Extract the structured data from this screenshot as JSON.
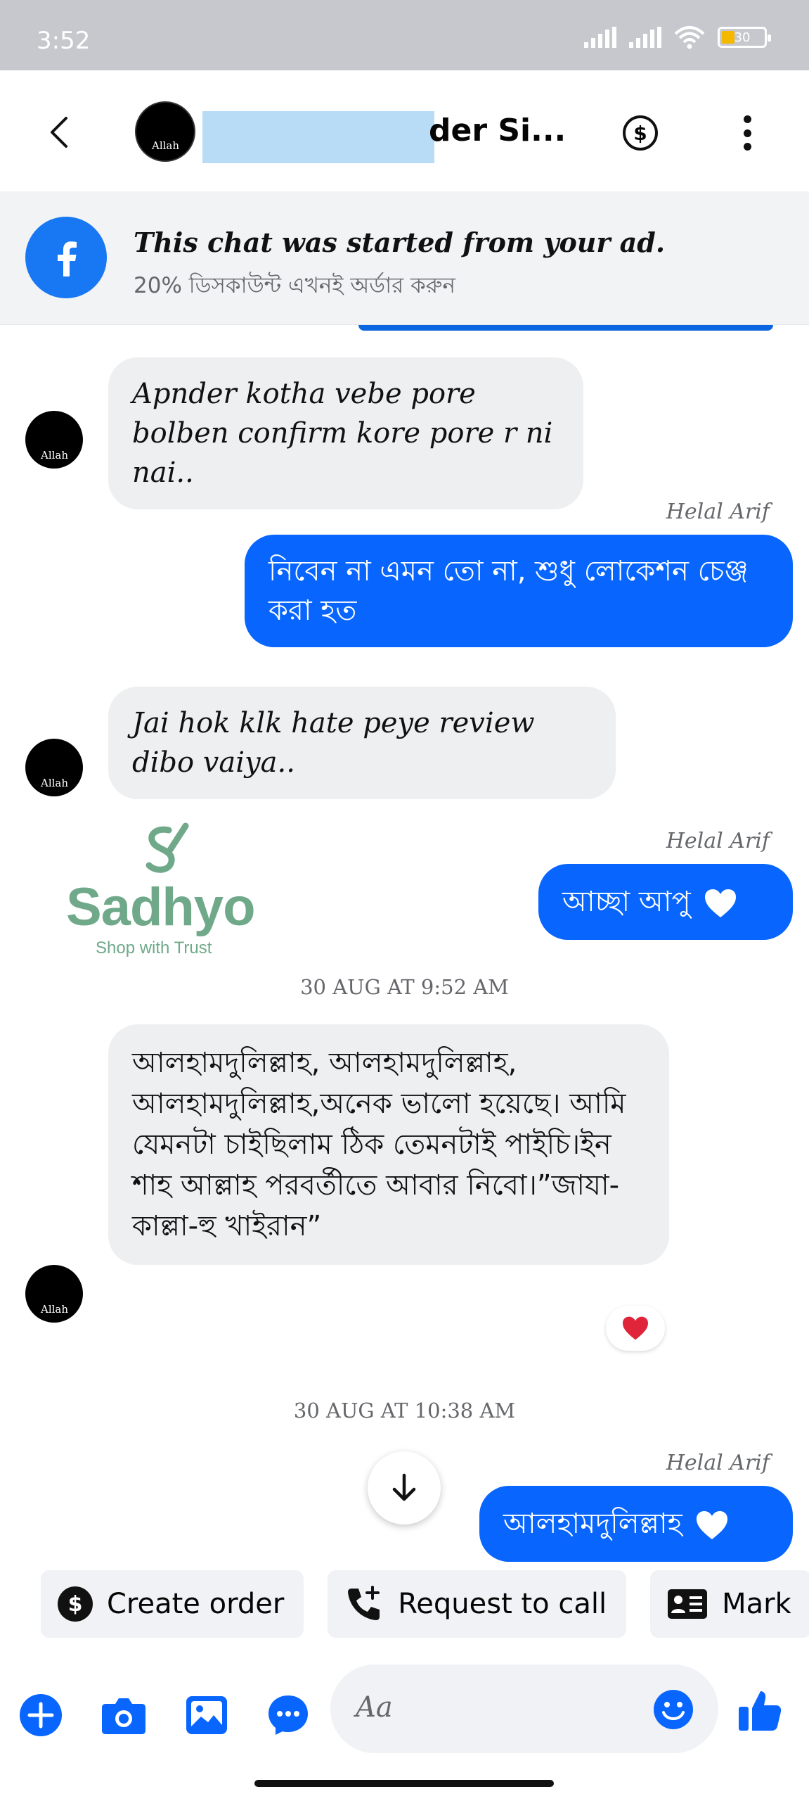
{
  "status_bar": {
    "time": "3:52",
    "battery": "30"
  },
  "header": {
    "avatar_text": "Allah",
    "title": "der Si..."
  },
  "ad_banner": {
    "title": "This chat was started from your ad.",
    "subtitle": "20% ডিসকাউন্ট এখনই অর্ডার করুন"
  },
  "messages": {
    "m1": {
      "text": "Apnder kotha vebe pore bolben confirm kore pore r ni nai..",
      "avatar": "Allah"
    },
    "m2": {
      "sender": "Helal Arif",
      "text": "নিবেন না এমন তো না, শুধু লোকেশন চেঞ্জ করা হত"
    },
    "m3": {
      "text": "Jai hok klk hate peye review dibo vaiya..",
      "avatar": "Allah"
    },
    "m4": {
      "sender": "Helal Arif",
      "text": "আচ্ছা আপু"
    },
    "ts1": "30 AUG AT 9:52 AM",
    "m5": {
      "text": "আলহামদুলিল্লাহ, আলহামদুলিল্লাহ, আলহামদুলিল্লাহ,অনেক ভালো হয়েছে। আমি যেমনটা চাইছিলাম ঠিক তেমনটাই পাইচি।ইন শাহ আল্লাহ পরবর্তীতে আবার নিবো।”জাযা-কাল্লা-হু খাইরান”",
      "avatar": "Allah"
    },
    "ts2": "30 AUG AT 10:38 AM",
    "m6": {
      "sender": "Helal Arif",
      "text": "আলহামদুলিল্লাহ"
    }
  },
  "watermark": {
    "name": "Sadhyo",
    "tagline": "Shop with Trust"
  },
  "quick_actions": [
    "Create order",
    "Request to call",
    "Mark"
  ],
  "composer": {
    "placeholder": "Aa"
  },
  "colors": {
    "accent": "#0866ff",
    "facebook": "#1877f2",
    "incoming_bubble": "#eeeff1",
    "logo": "#6fa98a",
    "heart": "#e0243a"
  }
}
